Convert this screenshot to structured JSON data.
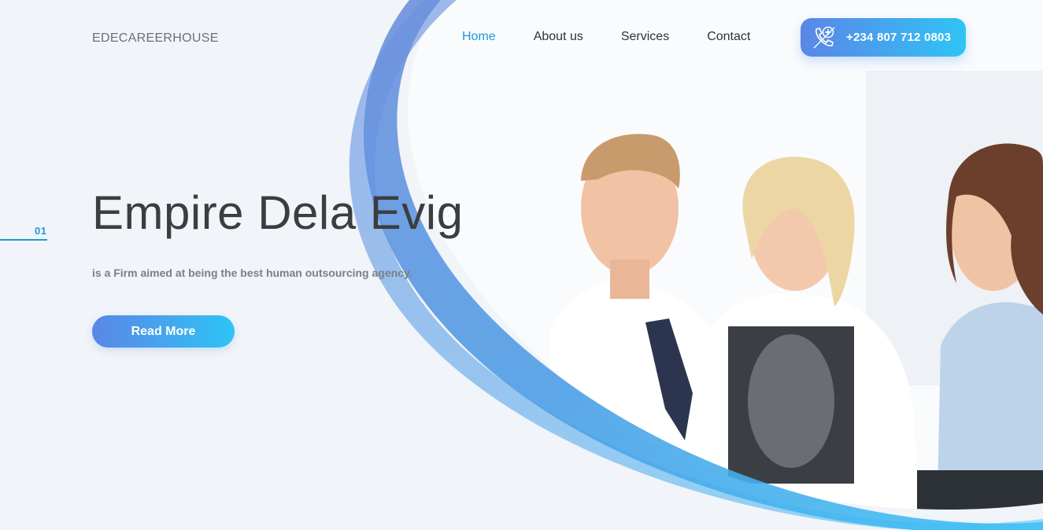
{
  "header": {
    "logo": "EDECAREERHOUSE",
    "nav": [
      {
        "label": "Home",
        "active": true
      },
      {
        "label": "About us",
        "active": false
      },
      {
        "label": "Services",
        "active": false
      },
      {
        "label": "Contact",
        "active": false
      }
    ],
    "phone": {
      "icon": "phone-medical-icon",
      "number": "+234 807 712 0803"
    }
  },
  "hero": {
    "slide_number": "01",
    "title": "Empire Dela Evig",
    "subtitle": "is a Firm aimed at being the best human outsourcing agency.",
    "cta_label": "Read More"
  },
  "theme": {
    "accent": "#1f9bd6",
    "gradient_start": "#5b86e6",
    "gradient_end": "#2fc4f5",
    "text_dark": "#3c3d40"
  }
}
